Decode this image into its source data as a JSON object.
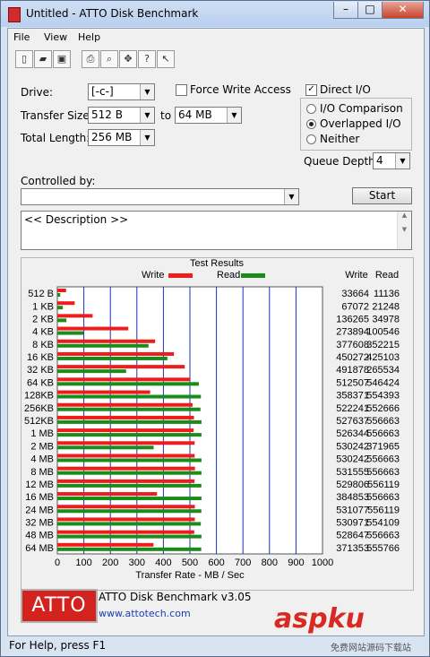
{
  "window": {
    "title": "Untitled - ATTO Disk Benchmark",
    "minimize": "–",
    "maximize": "□",
    "close": "✕"
  },
  "menu": [
    "File",
    "View",
    "Help"
  ],
  "toolbar": [
    "new-icon",
    "open-icon",
    "save-icon",
    "print-icon",
    "print-preview-icon",
    "move-icon",
    "help-icon",
    "context-help-icon"
  ],
  "drive": {
    "label": "Drive:",
    "value": "[-c-]"
  },
  "force_write": {
    "label": "Force Write Access",
    "checked": false
  },
  "direct_io": {
    "label": "Direct I/O",
    "checked": true
  },
  "transfer": {
    "label": "Transfer Size:",
    "from": "512 B",
    "to_label": "to",
    "to": "64 MB"
  },
  "total_length": {
    "label": "Total Length:",
    "value": "256 MB"
  },
  "io_mode": {
    "options": [
      "I/O Comparison",
      "Overlapped I/O",
      "Neither"
    ],
    "selected": "Overlapped I/O"
  },
  "queue_depth": {
    "label": "Queue Depth:",
    "value": "4"
  },
  "controlled_by": {
    "label": "Controlled by:",
    "value": ""
  },
  "start_button": "Start",
  "description": "<< Description >>",
  "chart_data": {
    "type": "bar",
    "title": "Test Results",
    "xlabel": "Transfer Rate - MB / Sec",
    "xlim": [
      0,
      1000
    ],
    "xticks": [
      0,
      100,
      200,
      300,
      400,
      500,
      600,
      700,
      800,
      900,
      1000
    ],
    "legend_position": "top",
    "categories": [
      "512 B",
      "1 KB",
      "2 KB",
      "4 KB",
      "8 KB",
      "16 KB",
      "32 KB",
      "64 KB",
      "128KB",
      "256KB",
      "512KB",
      "1 MB",
      "2 MB",
      "4 MB",
      "8 MB",
      "12 MB",
      "16 MB",
      "24 MB",
      "32 MB",
      "48 MB",
      "64 MB"
    ],
    "series": [
      {
        "name": "Write",
        "color": "#ee1c1c",
        "values": [
          33664,
          67072,
          136265,
          273894,
          377608,
          450272,
          491878,
          512507,
          358371,
          522241,
          527637,
          526344,
          530242,
          530242,
          531555,
          529806,
          384853,
          531077,
          530971,
          528647,
          371353
        ]
      },
      {
        "name": "Read",
        "color": "#1a8c1a",
        "values": [
          11136,
          21248,
          34978,
          100546,
          352215,
          425103,
          265534,
          546424,
          554393,
          552666,
          556663,
          556663,
          371965,
          556663,
          556663,
          556119,
          556663,
          556119,
          554109,
          556663,
          555766
        ]
      }
    ],
    "value_unit_note": "KB/s"
  },
  "column_headers": {
    "write": "Write",
    "read": "Read"
  },
  "brand": {
    "logo_text": "ATTO",
    "product": "ATTO Disk Benchmark v3.05",
    "url": "www.attotech.com"
  },
  "status": "For Help, press F1",
  "watermark": {
    "main": "aspku",
    "sub": "免费网站源码下载站"
  }
}
